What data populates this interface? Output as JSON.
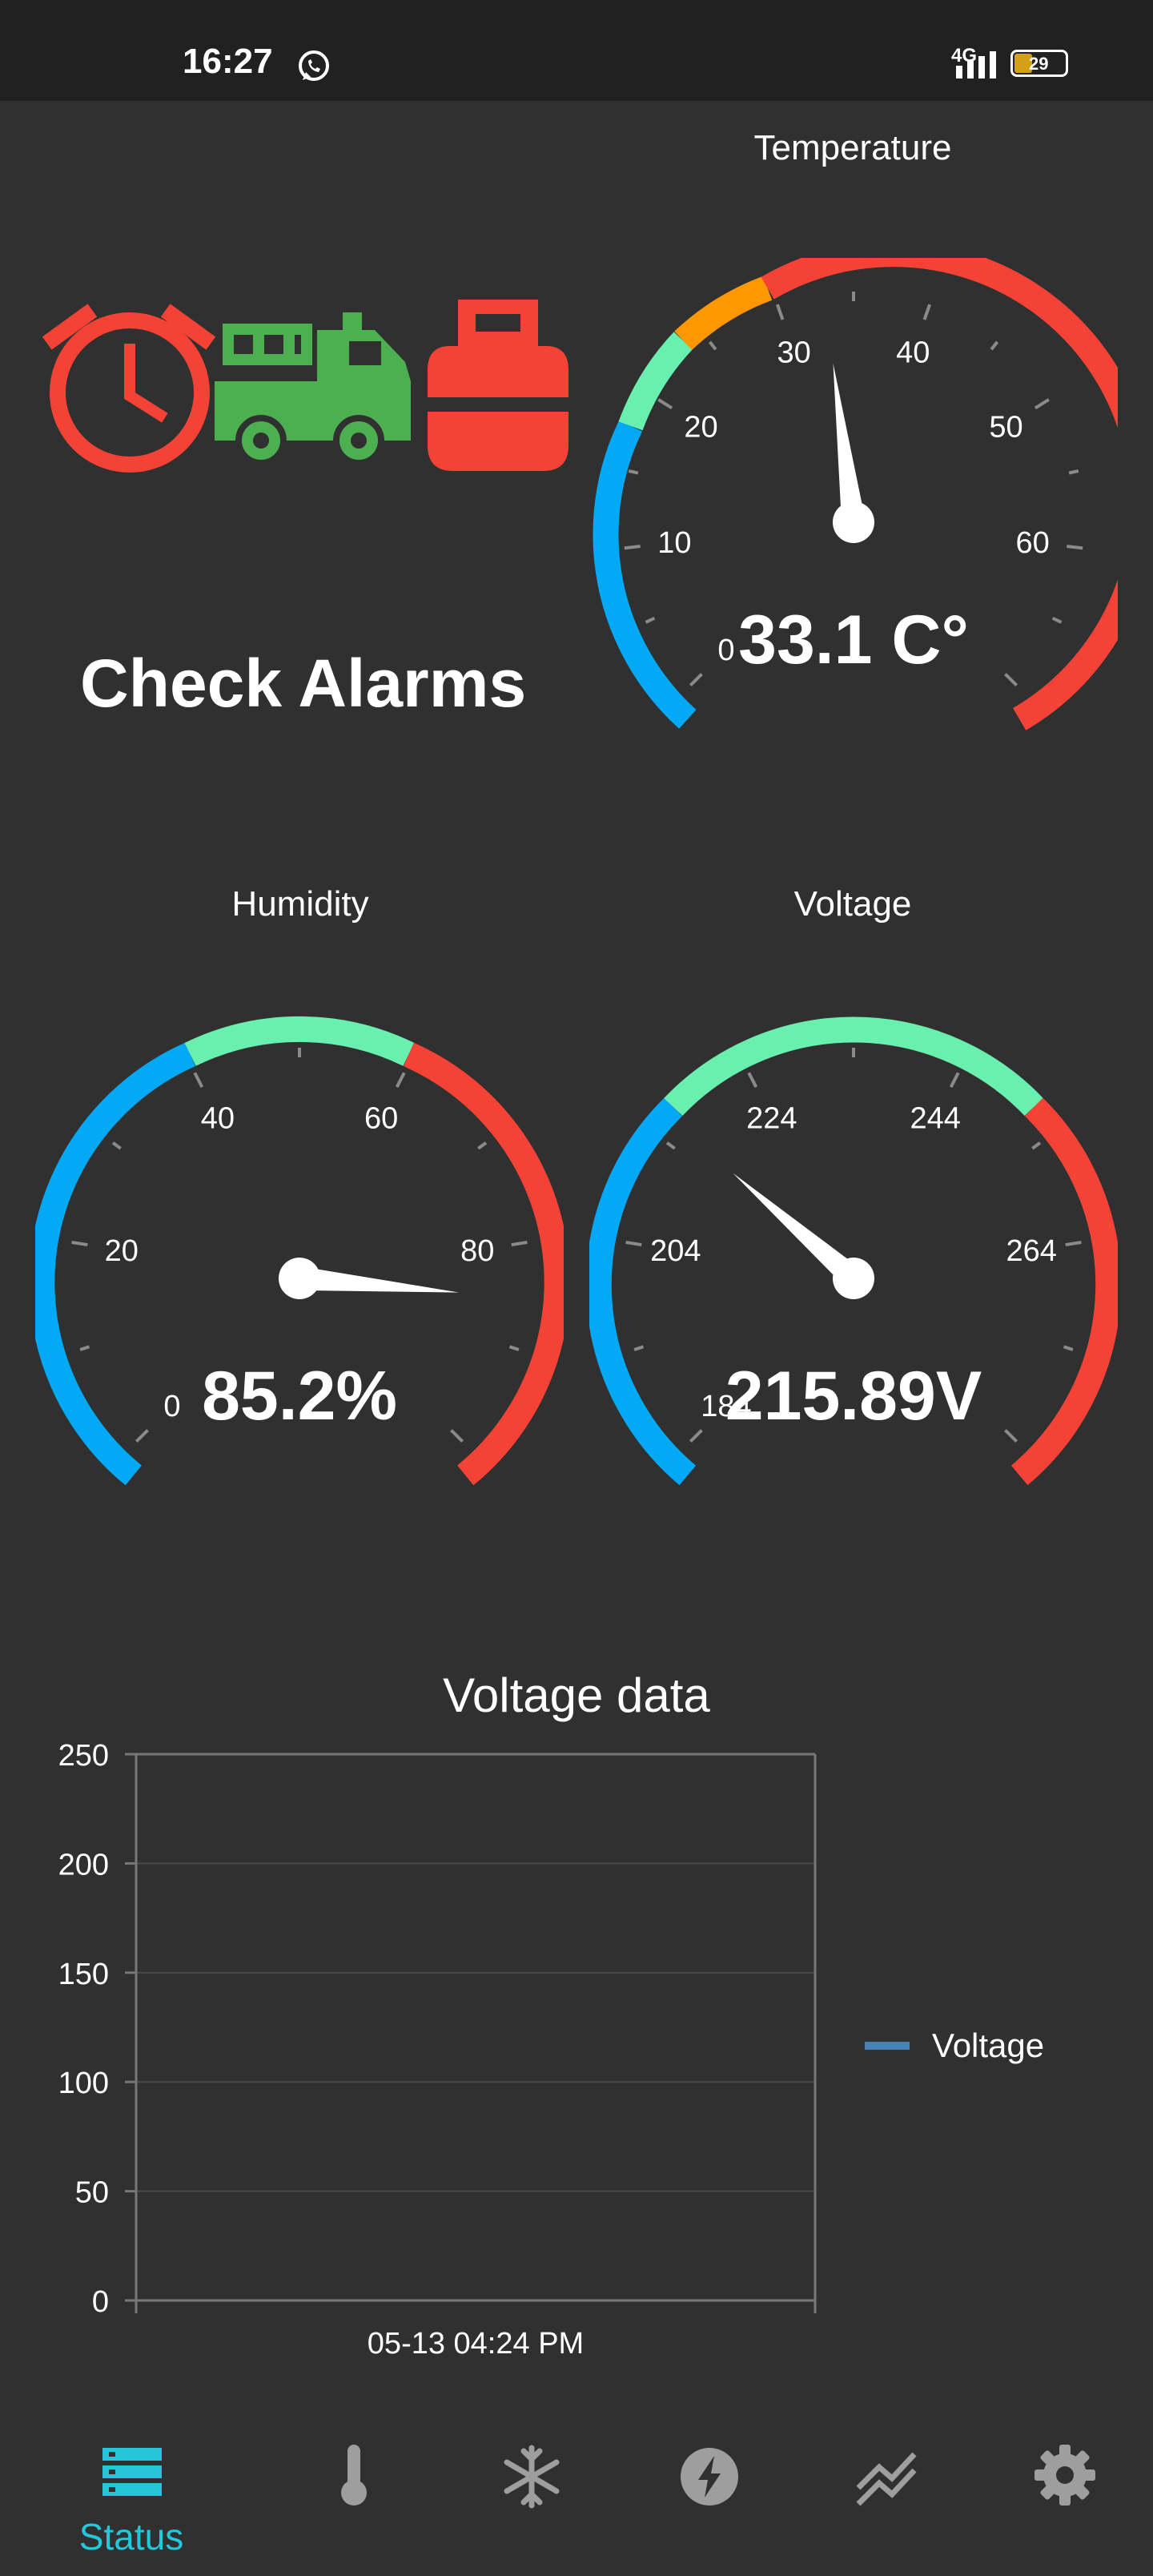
{
  "status_bar": {
    "time": "16:27",
    "network": "4G",
    "battery": "29"
  },
  "alarms": {
    "title": "Check Alarms",
    "icons": [
      "alarm-clock-icon",
      "fire-truck-icon",
      "gas-cylinder-icon"
    ],
    "colors": {
      "alarm": "#f44336",
      "truck": "#4caf50",
      "gas": "#f44336"
    }
  },
  "gauges": {
    "temperature": {
      "label": "Temperature",
      "value_text": "33.1 C°",
      "value": 33.1,
      "min": 0,
      "max": 70,
      "ticks": [
        "0",
        "10",
        "20",
        "30",
        "40",
        "50",
        "60"
      ]
    },
    "humidity": {
      "label": "Humidity",
      "value_text": "85.2%",
      "value": 85.2,
      "min": 0,
      "max": 100,
      "ticks": [
        "0",
        "20",
        "40",
        "60",
        "80"
      ]
    },
    "voltage": {
      "label": "Voltage",
      "value_text": "215.89V",
      "value": 215.89,
      "min": 184,
      "max": 284,
      "ticks": [
        "184",
        "204",
        "224",
        "244",
        "264"
      ]
    }
  },
  "chart_data": {
    "type": "line",
    "title": "Voltage data",
    "x": [
      "05-13 04:24 PM"
    ],
    "series": [
      {
        "name": "Voltage",
        "values": []
      }
    ],
    "ylim": [
      0,
      250
    ],
    "yticks": [
      "0",
      "50",
      "100",
      "150",
      "200",
      "250"
    ],
    "grid": true,
    "legend": "right",
    "color": "#4682b4"
  },
  "bottom_nav": {
    "active_label": "Status",
    "active_color": "#26c6da",
    "inactive_color": "#9e9e9e"
  }
}
